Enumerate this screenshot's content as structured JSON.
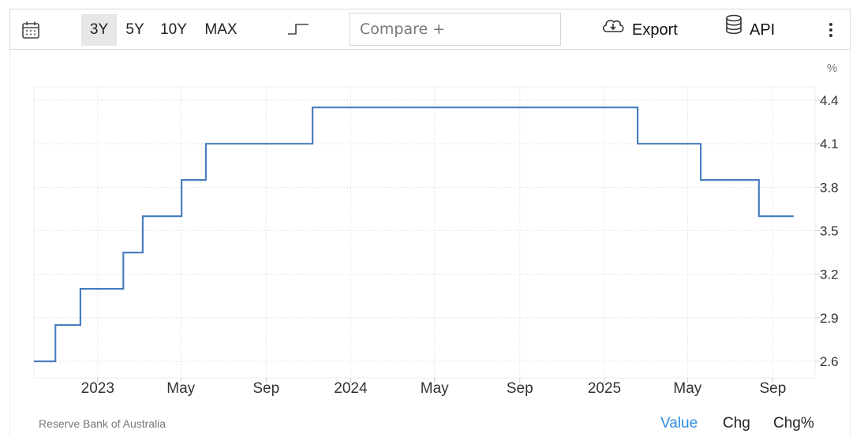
{
  "toolbar": {
    "ranges": [
      "3Y",
      "5Y",
      "10Y",
      "MAX"
    ],
    "active_range": "3Y",
    "compare_placeholder": "Compare +",
    "export_label": "Export",
    "api_label": "API",
    "icons": [
      "calendar-icon",
      "step-line-icon",
      "cloud-download-icon",
      "database-icon",
      "more-vertical-icon"
    ]
  },
  "footer": {
    "source": "Reserve Bank of Australia",
    "tabs": [
      "Value",
      "Chg",
      "Chg%"
    ],
    "active_tab": "Value"
  },
  "colors": {
    "line": "#4a7ebf",
    "active_tab": "#2e8ee6",
    "grid": "#e6e6e6"
  },
  "chart_data": {
    "type": "line",
    "style": "step",
    "unit_label": "%",
    "y_ticks": [
      2.6,
      2.9,
      3.2,
      3.5,
      3.8,
      4.1,
      4.4
    ],
    "ylim": [
      2.6,
      4.4
    ],
    "x_tick_labels": [
      {
        "date": "2023-01-01",
        "label": "2023"
      },
      {
        "date": "2023-05-01",
        "label": "May"
      },
      {
        "date": "2023-09-01",
        "label": "Sep"
      },
      {
        "date": "2024-01-01",
        "label": "2024"
      },
      {
        "date": "2024-05-01",
        "label": "May"
      },
      {
        "date": "2024-09-01",
        "label": "Sep"
      },
      {
        "date": "2025-01-01",
        "label": "2025"
      },
      {
        "date": "2025-05-01",
        "label": "May"
      },
      {
        "date": "2025-09-01",
        "label": "Sep"
      }
    ],
    "xlim": [
      "2022-10-01",
      "2025-11-01"
    ],
    "grid": true,
    "series": [
      {
        "points": [
          {
            "date": "2022-10-01",
            "value": 2.6
          },
          {
            "date": "2022-11-01",
            "value": 2.85
          },
          {
            "date": "2022-12-07",
            "value": 3.1
          },
          {
            "date": "2023-02-07",
            "value": 3.35
          },
          {
            "date": "2023-03-07",
            "value": 3.6
          },
          {
            "date": "2023-05-02",
            "value": 3.85
          },
          {
            "date": "2023-06-06",
            "value": 4.1
          },
          {
            "date": "2023-11-07",
            "value": 4.35
          },
          {
            "date": "2025-02-18",
            "value": 4.1
          },
          {
            "date": "2025-05-20",
            "value": 3.85
          },
          {
            "date": "2025-08-12",
            "value": 3.6
          },
          {
            "date": "2025-10-01",
            "value": 3.6
          }
        ]
      }
    ]
  }
}
